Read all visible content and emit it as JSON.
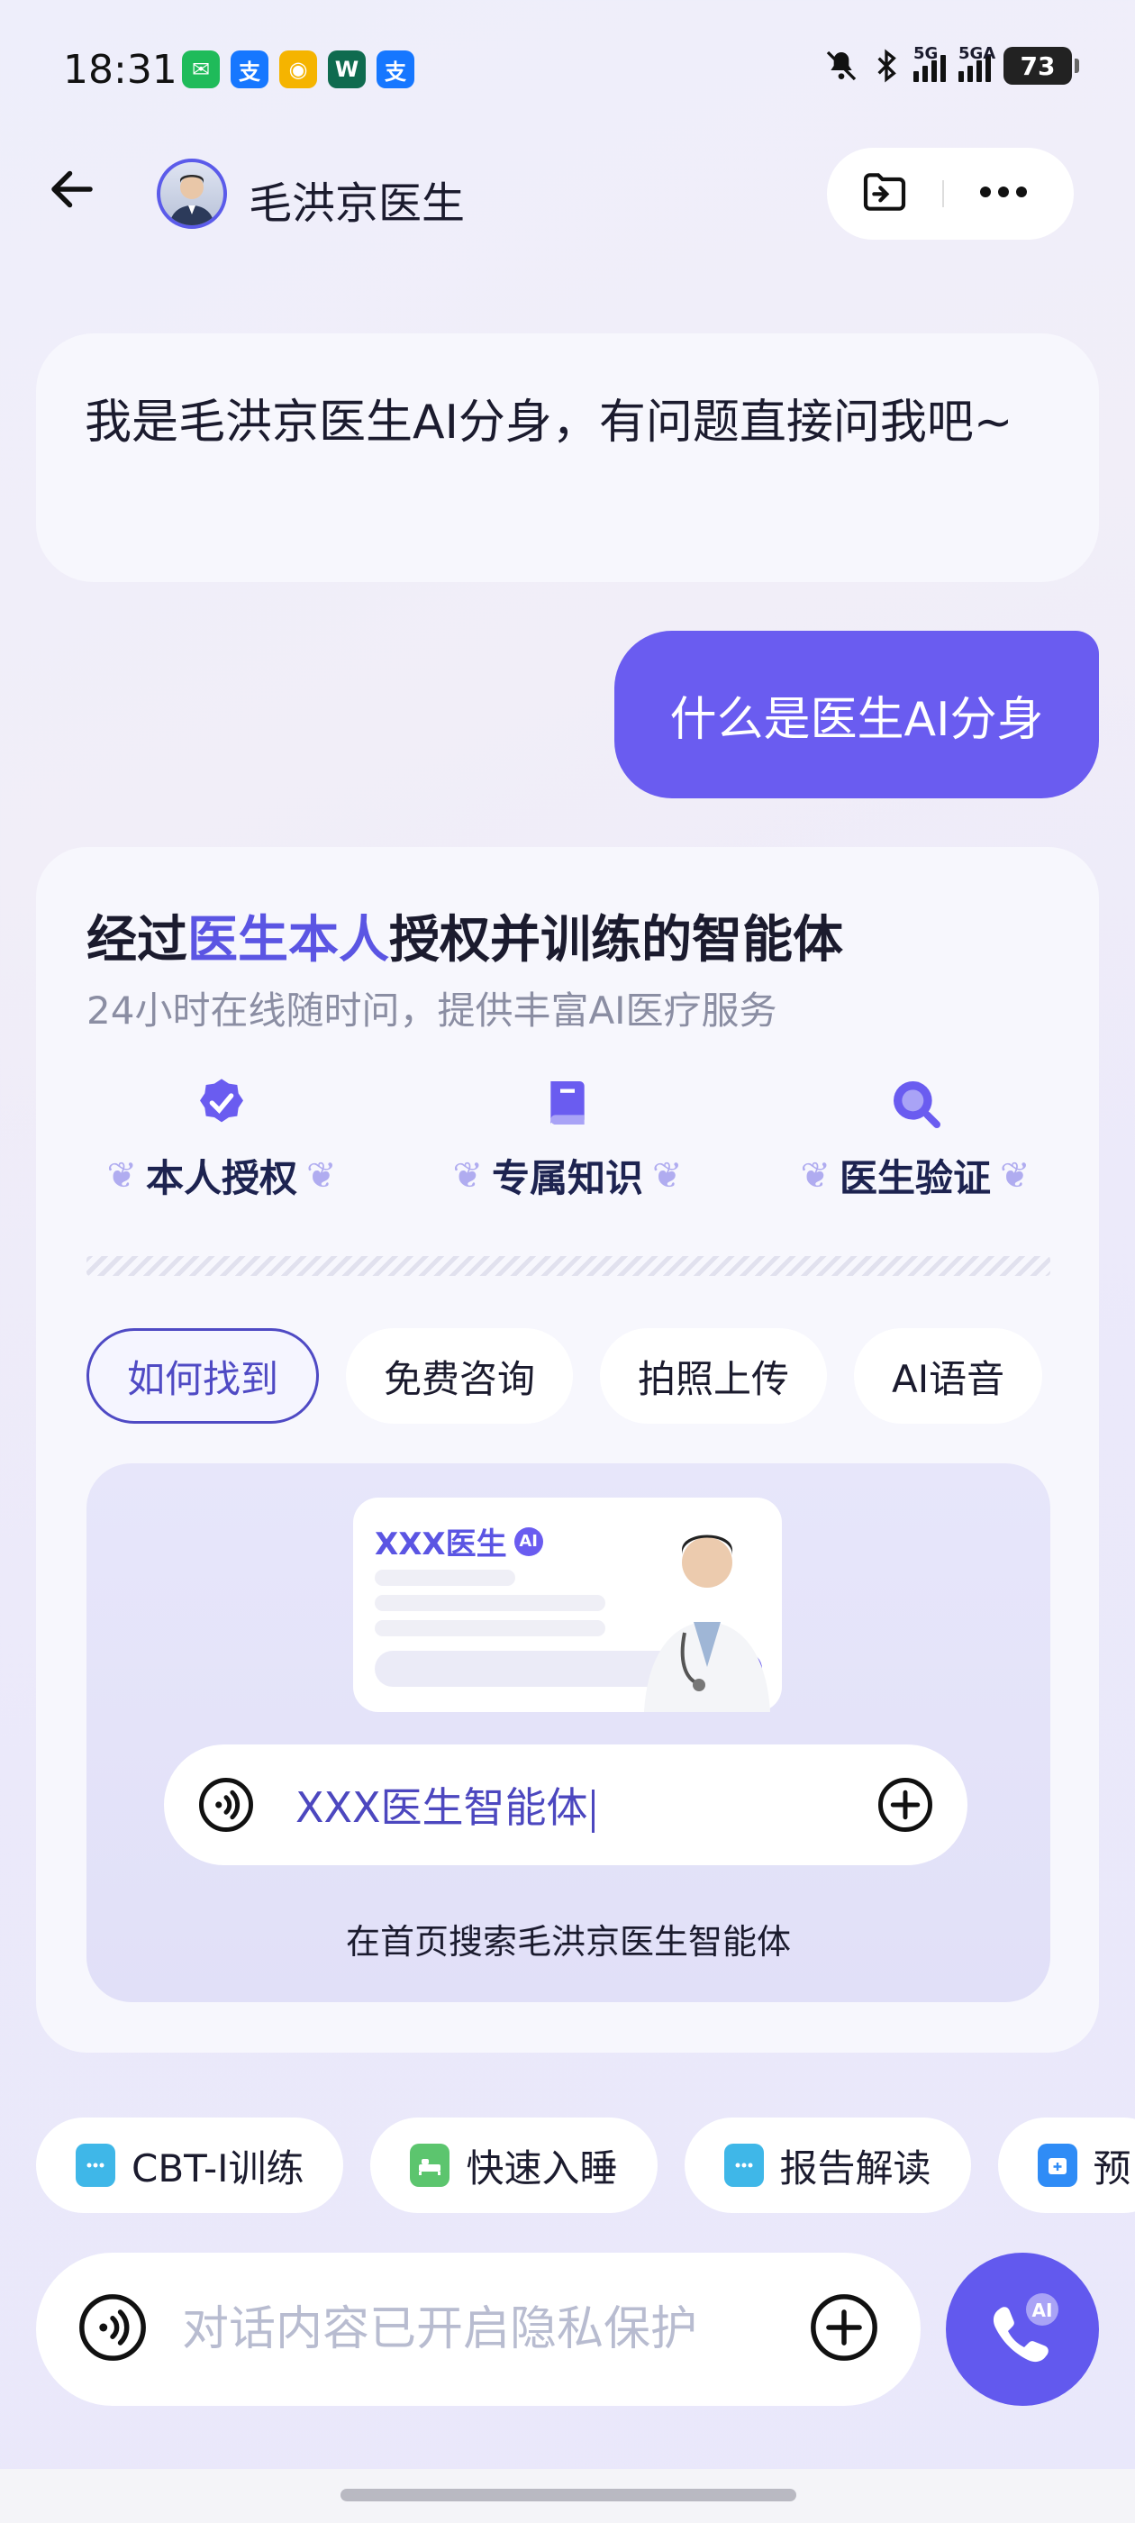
{
  "status_bar": {
    "time": "18:31",
    "apps": [
      {
        "icon": "wechat-icon",
        "glyph": "✉",
        "color": "#1fbb5a"
      },
      {
        "icon": "alipay-icon",
        "glyph": "支",
        "color": "#1677ff"
      },
      {
        "icon": "weibo-icon",
        "glyph": "◉",
        "color": "#f5b400"
      },
      {
        "icon": "app-icon",
        "glyph": "W",
        "color": "#0f6b4f"
      },
      {
        "icon": "alipay-icon-2",
        "glyph": "支",
        "color": "#1677ff"
      }
    ],
    "signal_1": "5G",
    "signal_2": "5GA",
    "battery": "73"
  },
  "header": {
    "doctor_name": "毛洪京医生"
  },
  "messages": {
    "ai_greeting": "我是毛洪京医生AI分身，有问题直接问我吧~",
    "user_question": "什么是医生AI分身"
  },
  "card": {
    "title_pre": "经过",
    "title_highlight": "医生本人",
    "title_post": "授权并训练的智能体",
    "subtitle": "24小时在线随时问，提供丰富AI医疗服务",
    "features": [
      {
        "label": "本人授权",
        "icon": "verified-icon"
      },
      {
        "label": "专属知识",
        "icon": "book-icon"
      },
      {
        "label": "医生验证",
        "icon": "magnifier-icon"
      }
    ],
    "tabs": [
      "如何找到",
      "免费咨询",
      "拍照上传",
      "AI语音"
    ],
    "demo": {
      "card_title": "XXX医生",
      "ai_badge": "AI",
      "search_text": "XXX医生智能体",
      "caption": "在首页搜索毛洪京医生智能体"
    }
  },
  "quick_actions": [
    {
      "label": "CBT-I训练",
      "icon": "document-icon",
      "color": "#3fb7e8"
    },
    {
      "label": "快速入睡",
      "icon": "sleep-icon",
      "color": "#5cc56e"
    },
    {
      "label": "报告解读",
      "icon": "report-icon",
      "color": "#3fb7e8"
    },
    {
      "label": "预",
      "icon": "calendar-icon",
      "color": "#2f8cf6"
    }
  ],
  "input": {
    "placeholder": "对话内容已开启隐私保护"
  },
  "colors": {
    "accent": "#6259ee",
    "highlight": "#5b55e3"
  }
}
